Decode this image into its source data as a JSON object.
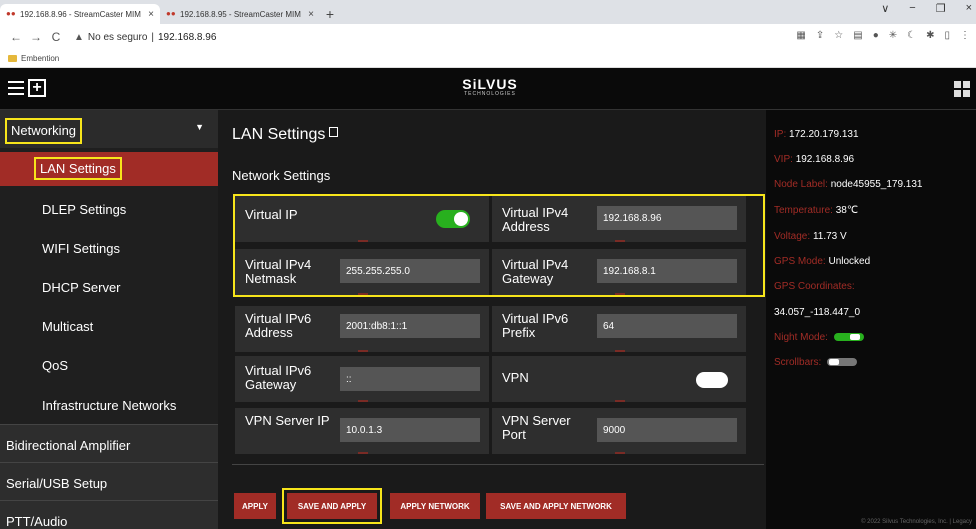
{
  "browser": {
    "tabs": [
      {
        "title": "192.168.8.96 - StreamCaster MIM",
        "close": "×"
      },
      {
        "title": "192.168.8.95 - StreamCaster MIM",
        "close": "×"
      }
    ],
    "new_tab": "+",
    "window_controls": [
      "∨",
      "−",
      "❐",
      "×"
    ],
    "security_label": "No es seguro",
    "url": "192.168.8.96",
    "bookmark": "Embention",
    "nav": {
      "back": "←",
      "forward": "→",
      "reload": "C"
    }
  },
  "header": {
    "brand": "SiLVUS",
    "brand_sub": "TECHNOLOGIES"
  },
  "sidebar": {
    "networking": "Networking",
    "sub_items": [
      {
        "label": "LAN Settings"
      },
      {
        "label": "DLEP Settings"
      },
      {
        "label": "WIFI Settings"
      },
      {
        "label": "DHCP Server"
      },
      {
        "label": "Multicast"
      },
      {
        "label": "QoS"
      },
      {
        "label": "Infrastructure Networks"
      }
    ],
    "top_items": [
      {
        "label": "Bidirectional Amplifier"
      },
      {
        "label": "Serial/USB Setup"
      },
      {
        "label": "PTT/Audio"
      }
    ]
  },
  "main": {
    "title": "LAN Settings",
    "section": "Network Settings",
    "fields": {
      "virtual_ip": {
        "label": "Virtual IP",
        "on": true
      },
      "virtual_ipv4_address": {
        "label": "Virtual IPv4 Address",
        "value": "192.168.8.96"
      },
      "virtual_ipv4_netmask": {
        "label": "Virtual IPv4 Netmask",
        "value": "255.255.255.0"
      },
      "virtual_ipv4_gateway": {
        "label": "Virtual IPv4 Gateway",
        "value": "192.168.8.1"
      },
      "virtual_ipv6_address": {
        "label": "Virtual IPv6 Address",
        "value": "2001:db8:1::1"
      },
      "virtual_ipv6_prefix": {
        "label": "Virtual IPv6 Prefix",
        "value": "64"
      },
      "virtual_ipv6_gateway": {
        "label": "Virtual IPv6 Gateway",
        "value": "::"
      },
      "vpn": {
        "label": "VPN",
        "on": false
      },
      "vpn_server_ip": {
        "label": "VPN Server IP",
        "value": "10.0.1.3"
      },
      "vpn_server_port": {
        "label": "VPN Server Port",
        "value": "9000"
      }
    },
    "buttons": {
      "apply": "APPLY",
      "save_and_apply": "SAVE AND APPLY",
      "apply_network": "APPLY NETWORK",
      "save_and_apply_network": "SAVE AND APPLY NETWORK"
    }
  },
  "status": {
    "ip_key": "IP:",
    "ip": "172.20.179.131",
    "vip_key": "VIP:",
    "vip": "192.168.8.96",
    "node_key": "Node Label:",
    "node": "node45955_179.131",
    "temp_key": "Temperature:",
    "temp": "38℃",
    "volt_key": "Voltage:",
    "volt": "11.73 V",
    "gps_mode_key": "GPS Mode:",
    "gps_mode": "Unlocked",
    "gps_coord_key": "GPS Coordinates:",
    "gps_coord": "34.057_-118.447_0",
    "night_key": "Night Mode:",
    "night_on": true,
    "scroll_key": "Scrollbars:",
    "scroll_on": false,
    "footer": "© 2022 Silvus Technologies, Inc. | Legacy"
  },
  "colors": {
    "accent": "#a12c26",
    "highlight": "#f7e51b",
    "toggle_on": "#28b01e"
  }
}
